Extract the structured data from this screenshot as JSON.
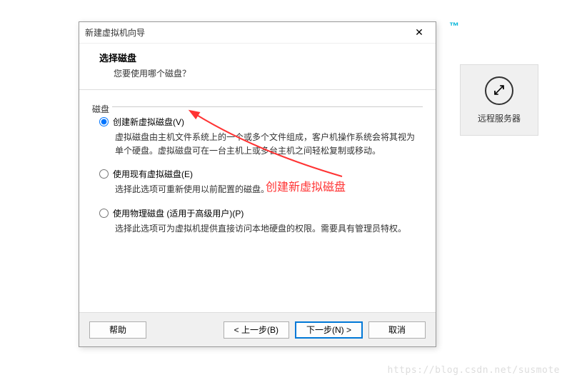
{
  "tm": "™",
  "remote": {
    "label": "远程服务器"
  },
  "dialog": {
    "title": "新建虚拟机向导",
    "close": "✕",
    "header": {
      "title": "选择磁盘",
      "sub": "您要使用哪个磁盘？"
    },
    "group_label": "磁盘",
    "options": [
      {
        "label": "创建新虚拟磁盘(V)",
        "desc": "虚拟磁盘由主机文件系统上的一个或多个文件组成，客户机操作系统会将其视为单个硬盘。虚拟磁盘可在一台主机上或多台主机之间轻松复制或移动。"
      },
      {
        "label": "使用现有虚拟磁盘(E)",
        "desc": "选择此选项可重新使用以前配置的磁盘。"
      },
      {
        "label": "使用物理磁盘 (适用于高级用户)(P)",
        "desc": "选择此选项可为虚拟机提供直接访问本地硬盘的权限。需要具有管理员特权。"
      }
    ],
    "buttons": {
      "help": "帮助",
      "back": "< 上一步(B)",
      "next": "下一步(N) >",
      "cancel": "取消"
    }
  },
  "annotation": "创建新虚拟磁盘",
  "watermark": "https://blog.csdn.net/susmote"
}
